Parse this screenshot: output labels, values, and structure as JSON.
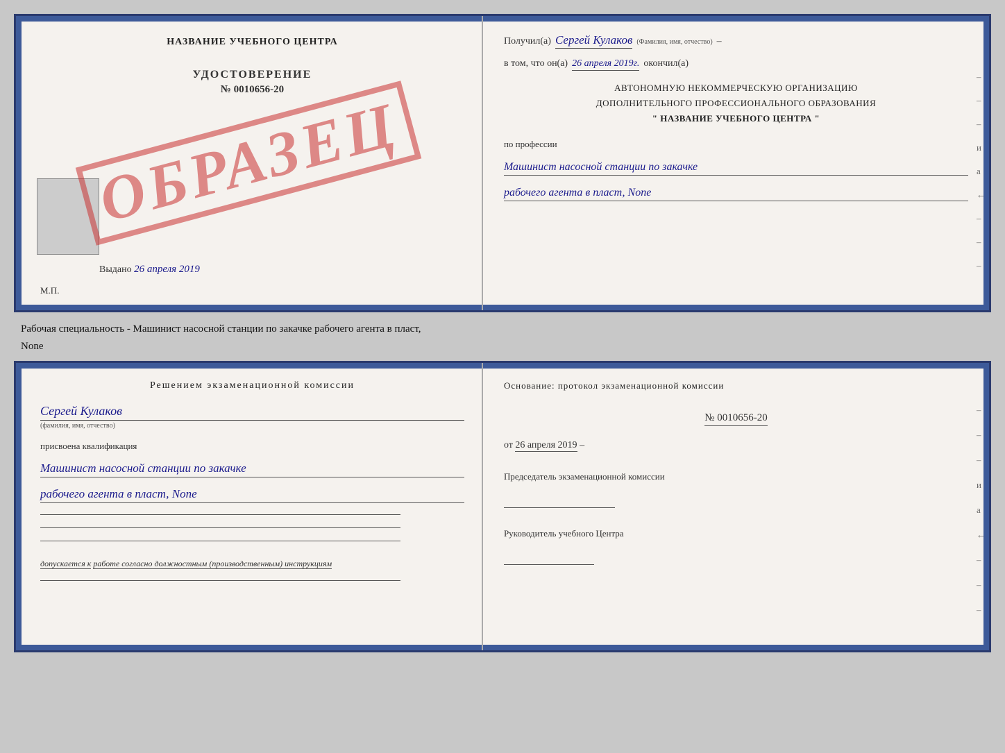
{
  "certTop": {
    "left": {
      "title": "НАЗВАНИЕ УЧЕБНОГО ЦЕНТРА",
      "stamp": "ОБРАЗЕЦ",
      "udostoverenie": "УДОСТОВЕРЕНИЕ",
      "number": "№ 0010656-20",
      "vydano_label": "Выдано",
      "vydano_date": "26 апреля 2019",
      "mp_label": "М.П."
    },
    "right": {
      "poluchil_label": "Получил(а)",
      "poluchil_name": "Сергей Кулаков",
      "familiya_label": "(Фамилия, имя, отчество)",
      "dash": "–",
      "v_tom_label": "в том, что он(а)",
      "v_tom_date": "26 апреля 2019г.",
      "okonchil_label": "окончил(а)",
      "org_line1": "АВТОНОМНУЮ НЕКОММЕРЧЕСКУЮ ОРГАНИЗАЦИЮ",
      "org_line2": "ДОПОЛНИТЕЛЬНОГО ПРОФЕССИОНАЛЬНОГО ОБРАЗОВАНИЯ",
      "org_name": "\" НАЗВАНИЕ УЧЕБНОГО ЦЕНТРА \"",
      "po_professii": "по профессии",
      "profession_line1": "Машинист насосной станции по закачке",
      "profession_line2": "рабочего агента в пласт, None"
    },
    "side_dashes": [
      "-",
      "-",
      "-",
      "и",
      "а",
      "←",
      "-",
      "-",
      "-"
    ]
  },
  "label_between": "Рабочая специальность - Машинист насосной станции по закачке рабочего агента в пласт,",
  "label_between2": "None",
  "certBottom": {
    "left": {
      "resheniem_title": "Решением  экзаменационной  комиссии",
      "name_handwritten": "Сергей Кулаков",
      "familiya_label": "(фамилия, имя, отчество)",
      "prisvoena": "присвоена квалификация",
      "qual_line1": "Машинист насосной станции по закачке",
      "qual_line2": "рабочего агента в пласт, None",
      "dopuskaetsya_label": "допускается к",
      "dopuskaetsya_value": "работе согласно должностным (производственным) инструкциям"
    },
    "right": {
      "osnov_label": "Основание:  протокол  экзаменационной  комиссии",
      "protocol_number": "№  0010656-20",
      "ot_label": "от",
      "ot_date": "26 апреля 2019",
      "predsedatel_label": "Председатель экзаменационной комиссии",
      "rukovoditel_label": "Руководитель учебного Центра"
    },
    "side_dashes": [
      "-",
      "-",
      "-",
      "и",
      "а",
      "←",
      "-",
      "-",
      "-"
    ]
  }
}
